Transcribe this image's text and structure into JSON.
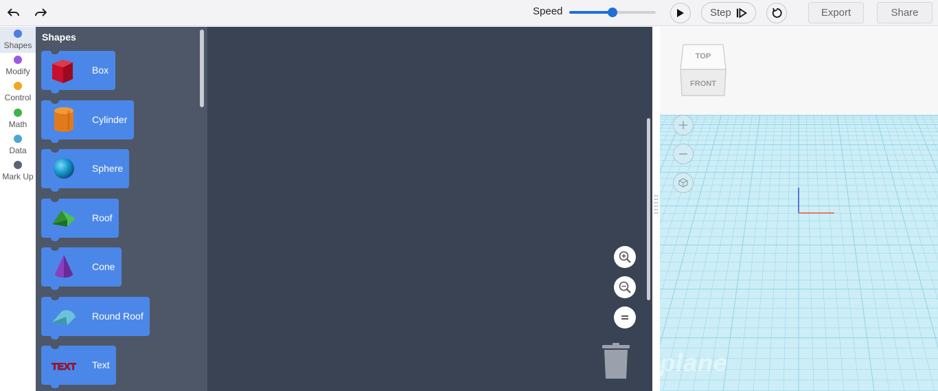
{
  "toolbar": {
    "undo_icon": "undo-icon",
    "redo_icon": "redo-icon",
    "speed_label": "Speed",
    "speed_value": 0.5,
    "play_icon": "play-icon",
    "step_label": "Step",
    "step_icon": "step-forward-icon",
    "reset_icon": "reset-icon",
    "export_label": "Export",
    "share_label": "Share",
    "accent_color": "#1f6fd6"
  },
  "categories": [
    {
      "label": "Shapes",
      "color": "#4a7fe0",
      "selected": true
    },
    {
      "label": "Modify",
      "color": "#9b59e6",
      "selected": false
    },
    {
      "label": "Control",
      "color": "#f2a51f",
      "selected": false
    },
    {
      "label": "Math",
      "color": "#3fb34a",
      "selected": false
    },
    {
      "label": "Data",
      "color": "#4ba6d6",
      "selected": false
    },
    {
      "label": "Mark Up",
      "color": "#5b6475",
      "selected": false
    }
  ],
  "flyout": {
    "title": "Shapes",
    "blocks": [
      {
        "label": "Box",
        "icon": "box-shape-icon"
      },
      {
        "label": "Cylinder",
        "icon": "cylinder-shape-icon"
      },
      {
        "label": "Sphere",
        "icon": "sphere-shape-icon"
      },
      {
        "label": "Roof",
        "icon": "roof-shape-icon"
      },
      {
        "label": "Cone",
        "icon": "cone-shape-icon"
      },
      {
        "label": "Round Roof",
        "icon": "round-roof-shape-icon"
      },
      {
        "label": "Text",
        "icon": "text-shape-icon"
      }
    ]
  },
  "workspace": {
    "zoom_in_icon": "zoom-in-icon",
    "zoom_out_icon": "zoom-out-icon",
    "zoom_reset_icon": "zoom-reset-icon",
    "trash_icon": "trash-icon",
    "background_color": "#394354"
  },
  "viewport": {
    "view_cube": {
      "top_label": "TOP",
      "front_label": "FRONT"
    },
    "zoom_in_icon": "plus-icon",
    "zoom_out_icon": "minus-icon",
    "home_view_icon": "home-cube-icon",
    "plane_watermark": "plane",
    "grid_color": "#8fd3e6"
  }
}
